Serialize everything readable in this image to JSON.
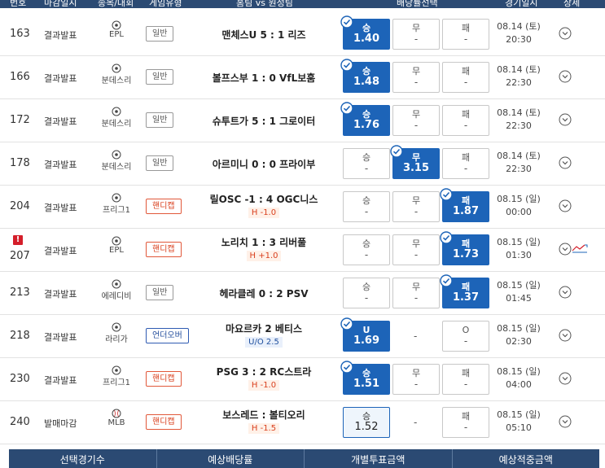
{
  "header": {
    "cols": [
      "번호",
      "마감일시",
      "종목/대회",
      "게임유형",
      "홈팀 vs 원정팀",
      "배당률선택",
      "경기일시",
      "상세"
    ]
  },
  "rows": [
    {
      "num": "163",
      "status": "결과발표",
      "league": "EPL",
      "sport_icon": "soccer-ball-icon",
      "type": "일반",
      "type_kind": "normal",
      "match": "맨체스U 5 : 1 리즈",
      "sub": "",
      "sub_kind": "",
      "odds": [
        {
          "label": "승",
          "value": "1.40",
          "state": "sel",
          "check": true
        },
        {
          "label": "무",
          "value": "-",
          "state": "",
          "check": false
        },
        {
          "label": "패",
          "value": "-",
          "state": "",
          "check": false
        }
      ],
      "date": "08.14 (토)",
      "time": "20:30",
      "alert": "",
      "trend": false
    },
    {
      "num": "166",
      "status": "결과발표",
      "league": "분데스리",
      "sport_icon": "soccer-ball-icon",
      "type": "일반",
      "type_kind": "normal",
      "match": "볼프스부 1 : 0 VfL보훔",
      "sub": "",
      "sub_kind": "",
      "odds": [
        {
          "label": "승",
          "value": "1.48",
          "state": "sel",
          "check": true
        },
        {
          "label": "무",
          "value": "-",
          "state": "",
          "check": false
        },
        {
          "label": "패",
          "value": "-",
          "state": "",
          "check": false
        }
      ],
      "date": "08.14 (토)",
      "time": "22:30",
      "alert": "",
      "trend": false
    },
    {
      "num": "172",
      "status": "결과발표",
      "league": "분데스리",
      "sport_icon": "soccer-ball-icon",
      "type": "일반",
      "type_kind": "normal",
      "match": "슈투트가 5 : 1 그로이터",
      "sub": "",
      "sub_kind": "",
      "odds": [
        {
          "label": "승",
          "value": "1.76",
          "state": "sel",
          "check": true
        },
        {
          "label": "무",
          "value": "-",
          "state": "",
          "check": false
        },
        {
          "label": "패",
          "value": "-",
          "state": "",
          "check": false
        }
      ],
      "date": "08.14 (토)",
      "time": "22:30",
      "alert": "",
      "trend": false
    },
    {
      "num": "178",
      "status": "결과발표",
      "league": "분데스리",
      "sport_icon": "soccer-ball-icon",
      "type": "일반",
      "type_kind": "normal",
      "match": "아르미니 0 : 0 프라이부",
      "sub": "",
      "sub_kind": "",
      "odds": [
        {
          "label": "승",
          "value": "-",
          "state": "",
          "check": false
        },
        {
          "label": "무",
          "value": "3.15",
          "state": "sel",
          "check": true
        },
        {
          "label": "패",
          "value": "-",
          "state": "",
          "check": false
        }
      ],
      "date": "08.14 (토)",
      "time": "22:30",
      "alert": "",
      "trend": false
    },
    {
      "num": "204",
      "status": "결과발표",
      "league": "프리그1",
      "sport_icon": "soccer-ball-icon",
      "type": "핸디캡",
      "type_kind": "hc",
      "match": "릴OSC -1 : 4 OGC니스",
      "sub": "H -1.0",
      "sub_kind": "h",
      "odds": [
        {
          "label": "승",
          "value": "-",
          "state": "",
          "check": false
        },
        {
          "label": "무",
          "value": "-",
          "state": "",
          "check": false
        },
        {
          "label": "패",
          "value": "1.87",
          "state": "sel",
          "check": true
        }
      ],
      "date": "08.15 (일)",
      "time": "00:00",
      "alert": "",
      "trend": false
    },
    {
      "num": "207",
      "status": "결과발표",
      "league": "EPL",
      "sport_icon": "soccer-ball-icon",
      "type": "핸디캡",
      "type_kind": "hc",
      "match": "노리치 1 : 3 리버풀",
      "sub": "H +1.0",
      "sub_kind": "h",
      "odds": [
        {
          "label": "승",
          "value": "-",
          "state": "",
          "check": false
        },
        {
          "label": "무",
          "value": "-",
          "state": "",
          "check": false
        },
        {
          "label": "패",
          "value": "1.73",
          "state": "sel",
          "check": true
        }
      ],
      "date": "08.15 (일)",
      "time": "01:30",
      "alert": "!",
      "trend": true
    },
    {
      "num": "213",
      "status": "결과발표",
      "league": "에레디비",
      "sport_icon": "soccer-ball-icon",
      "type": "일반",
      "type_kind": "normal",
      "match": "헤라클레 0 : 2 PSV",
      "sub": "",
      "sub_kind": "",
      "odds": [
        {
          "label": "승",
          "value": "-",
          "state": "",
          "check": false
        },
        {
          "label": "무",
          "value": "-",
          "state": "",
          "check": false
        },
        {
          "label": "패",
          "value": "1.37",
          "state": "sel",
          "check": true
        }
      ],
      "date": "08.15 (일)",
      "time": "01:45",
      "alert": "",
      "trend": false
    },
    {
      "num": "218",
      "status": "결과발표",
      "league": "라리가",
      "sport_icon": "soccer-ball-icon",
      "type": "언더오버",
      "type_kind": "uo",
      "match": "마요르카   2   베티스",
      "sub": "U/O 2.5",
      "sub_kind": "uo",
      "odds": [
        {
          "label": "U",
          "value": "1.69",
          "state": "sel",
          "check": true
        },
        {
          "label": "",
          "value": "",
          "state": "none",
          "check": false
        },
        {
          "label": "O",
          "value": "-",
          "state": "",
          "check": false
        }
      ],
      "mid": "-",
      "date": "08.15 (일)",
      "time": "02:30",
      "alert": "",
      "trend": false
    },
    {
      "num": "230",
      "status": "결과발표",
      "league": "프리그1",
      "sport_icon": "soccer-ball-icon",
      "type": "핸디캡",
      "type_kind": "hc",
      "match": "PSG 3 : 2 RC스트라",
      "sub": "H -1.0",
      "sub_kind": "h",
      "odds": [
        {
          "label": "승",
          "value": "1.51",
          "state": "sel",
          "check": true
        },
        {
          "label": "무",
          "value": "-",
          "state": "",
          "check": false
        },
        {
          "label": "패",
          "value": "-",
          "state": "",
          "check": false
        }
      ],
      "date": "08.15 (일)",
      "time": "04:00",
      "alert": "",
      "trend": false
    },
    {
      "num": "240",
      "status": "발매마감",
      "league": "MLB",
      "sport_icon": "baseball-icon",
      "type": "핸디캡",
      "type_kind": "hc",
      "match": "보스레드 : 볼티오리",
      "sub": "H -1.5",
      "sub_kind": "h",
      "odds": [
        {
          "label": "승",
          "value": "1.52",
          "state": "blue",
          "check": false
        },
        {
          "label": "",
          "value": "",
          "state": "none",
          "check": false
        },
        {
          "label": "패",
          "value": "-",
          "state": "",
          "check": false
        }
      ],
      "mid": "-",
      "date": "08.15 (일)",
      "time": "05:10",
      "alert": "",
      "trend": false
    }
  ],
  "summary": {
    "cols": [
      "선택경기수",
      "예상배당률",
      "개별투표금액",
      "예상적중금액"
    ]
  },
  "colors": {
    "header": "#2b4a73",
    "selected": "#1d64b8",
    "handicap": "#d9401e",
    "underover": "#234d9c"
  }
}
